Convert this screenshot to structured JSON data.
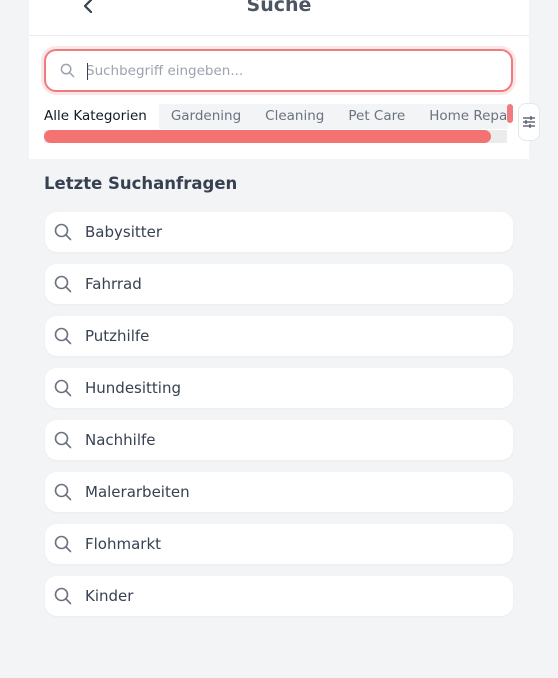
{
  "header": {
    "title": "Suche"
  },
  "search": {
    "placeholder": "Suchbegriff eingeben...",
    "value": ""
  },
  "categories": [
    {
      "label": "Alle Kategorien",
      "active": true
    },
    {
      "label": "Gardening",
      "active": false
    },
    {
      "label": "Cleaning",
      "active": false
    },
    {
      "label": "Pet Care",
      "active": false
    },
    {
      "label": "Home Repair",
      "active": false
    }
  ],
  "recent": {
    "title": "Letzte Suchanfragen",
    "items": [
      "Babysitter",
      "Fahrrad",
      "Putzhilfe",
      "Hundesitting",
      "Nachhilfe",
      "Malerarbeiten",
      "Flohmarkt",
      "Kinder"
    ]
  },
  "colors": {
    "accent": "#f07a7e",
    "scroll_thumb": "#f37373",
    "background": "#f3f4f6"
  },
  "icons": {
    "back": "chevron-left-icon",
    "search": "search-icon",
    "filter": "sliders-icon"
  }
}
